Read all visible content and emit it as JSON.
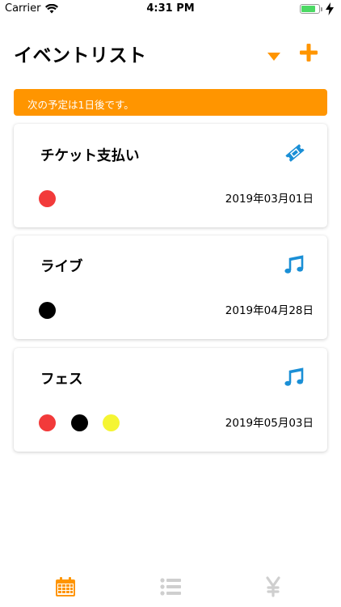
{
  "status_bar": {
    "carrier": "Carrier",
    "time": "4:31 PM",
    "battery_level": 0.82
  },
  "header": {
    "title": "イベントリスト",
    "sort_icon": "triangle-down-icon",
    "add_icon": "plus-icon",
    "accent_color": "#ff9500"
  },
  "banner": {
    "text": "次の予定は1日後です。",
    "color": "#ff9500"
  },
  "events": [
    {
      "title": "チケット支払い",
      "icon": "ticket-icon",
      "date": "2019年03月01日",
      "dots": [
        "#f23a3a"
      ]
    },
    {
      "title": "ライブ",
      "icon": "music-note-icon",
      "date": "2019年04月28日",
      "dots": [
        "#000000"
      ]
    },
    {
      "title": "フェス",
      "icon": "music-note-icon",
      "date": "2019年05月03日",
      "dots": [
        "#f23a3a",
        "#000000",
        "#f5f533"
      ]
    }
  ],
  "icon_color": "#1a8fd6",
  "tab_bar": {
    "tabs": [
      {
        "icon": "calendar-icon",
        "selected": true
      },
      {
        "icon": "list-icon",
        "selected": false
      },
      {
        "icon": "yen-icon",
        "selected": false
      }
    ],
    "active_color": "#ff9500",
    "inactive_color": "#cfcfcf"
  }
}
